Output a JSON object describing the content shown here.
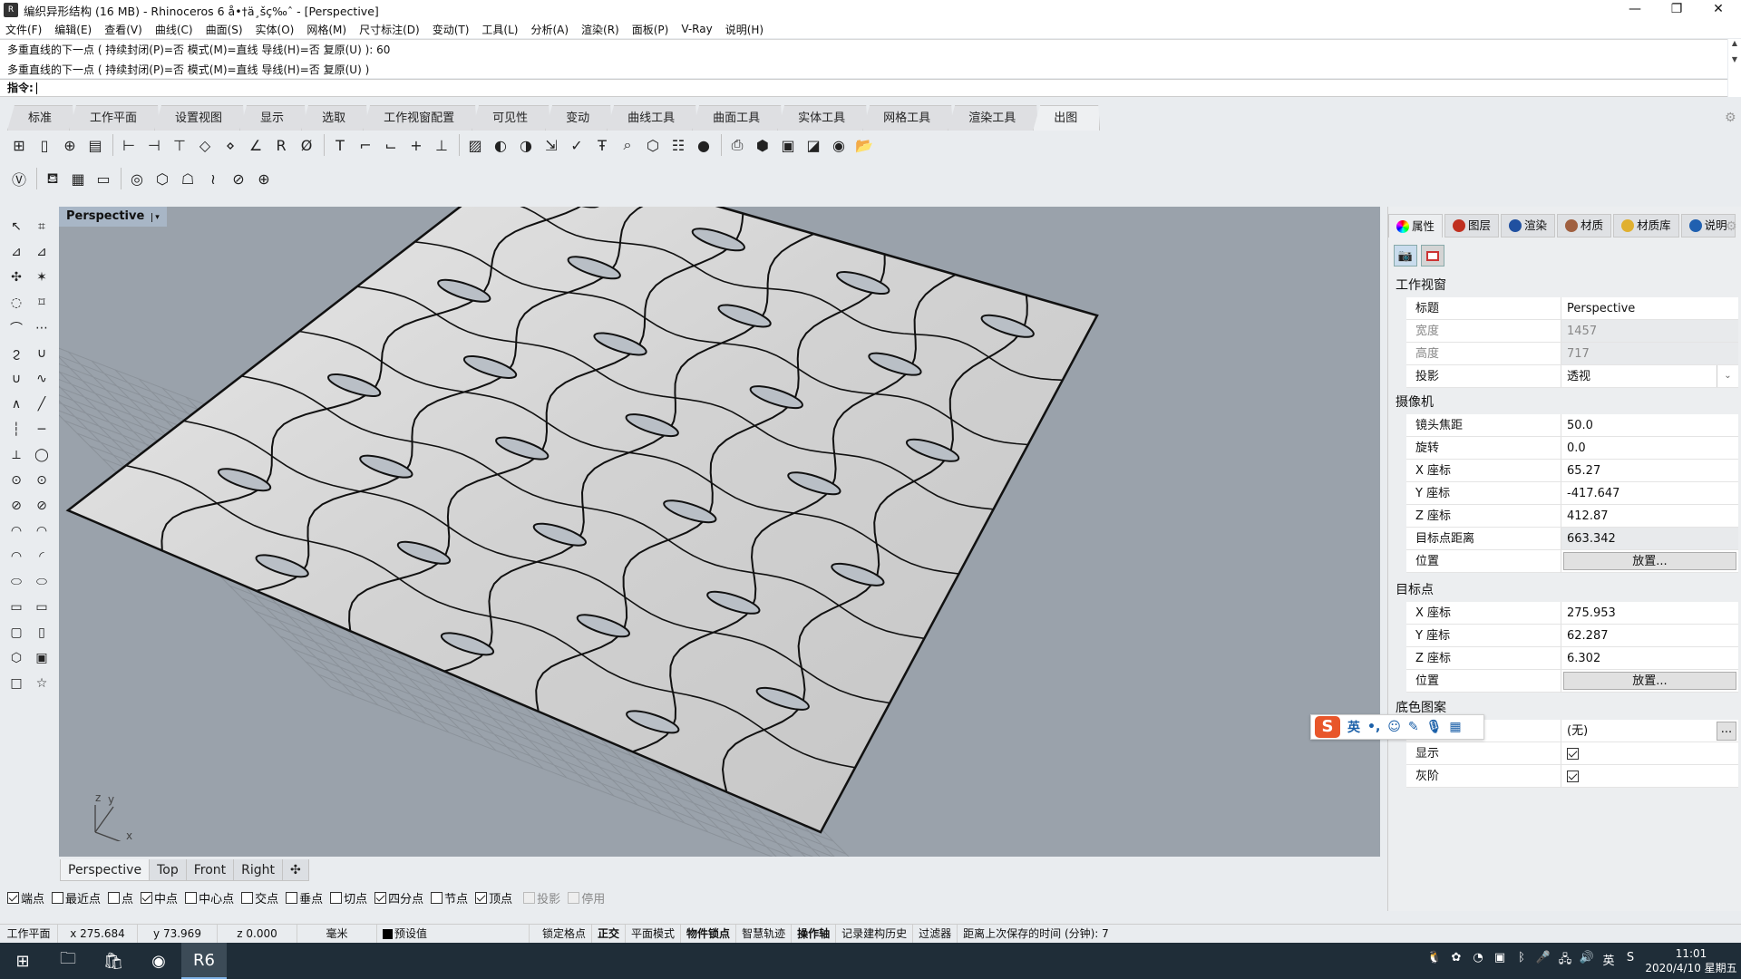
{
  "window": {
    "title": "编织异形结构 (16 MB) - Rhinoceros 6 å•†ä¸šç‰ˆ - [Perspective]",
    "app_icon": "rhino-app-icon",
    "controls": [
      "minimize-icon",
      "restore-icon",
      "close-icon"
    ],
    "minimize": "—",
    "restore": "❐",
    "close": "✕"
  },
  "menu": [
    "文件(F)",
    "编辑(E)",
    "查看(V)",
    "曲线(C)",
    "曲面(S)",
    "实体(O)",
    "网格(M)",
    "尺寸标注(D)",
    "变动(T)",
    "工具(L)",
    "分析(A)",
    "渲染(R)",
    "面板(P)",
    "V-Ray",
    "说明(H)"
  ],
  "command": {
    "history": [
      "多重直线的下一点 ( 持续封闭(P)=否  模式(M)=直线  导线(H)=否  复原(U) ): 60",
      "多重直线的下一点 ( 持续封闭(P)=否  模式(M)=直线  导线(H)=否  复原(U) )"
    ],
    "prompt_label": "指令:",
    "input_value": ""
  },
  "ribbon_tabs": [
    {
      "label": "标准",
      "active": false
    },
    {
      "label": "工作平面",
      "active": false
    },
    {
      "label": "设置视图",
      "active": false
    },
    {
      "label": "显示",
      "active": false
    },
    {
      "label": "选取",
      "active": false
    },
    {
      "label": "工作视窗配置",
      "active": false
    },
    {
      "label": "可见性",
      "active": false
    },
    {
      "label": "变动",
      "active": false
    },
    {
      "label": "曲线工具",
      "active": false
    },
    {
      "label": "曲面工具",
      "active": false
    },
    {
      "label": "实体工具",
      "active": false
    },
    {
      "label": "网格工具",
      "active": false
    },
    {
      "label": "渲染工具",
      "active": false
    },
    {
      "label": "出图",
      "active": true
    }
  ],
  "toolbar_row1": [
    {
      "icon": "layout-4view-icon",
      "glyph": "⊞"
    },
    {
      "icon": "new-page-icon",
      "glyph": "▯"
    },
    {
      "icon": "add-page-icon",
      "glyph": "⊕"
    },
    {
      "icon": "page-properties-icon",
      "glyph": "▤"
    },
    {
      "sep": true
    },
    {
      "icon": "dim-linear-icon",
      "glyph": "⊢"
    },
    {
      "icon": "dim-aligned-icon",
      "glyph": "⊣"
    },
    {
      "icon": "dim-rotated-icon",
      "glyph": "⊤"
    },
    {
      "icon": "dim-vertical-icon",
      "glyph": "◇"
    },
    {
      "icon": "dim-ordinate-icon",
      "glyph": "⋄"
    },
    {
      "icon": "dim-angle-icon",
      "glyph": "∠"
    },
    {
      "icon": "dim-radius-icon",
      "glyph": "R"
    },
    {
      "icon": "dim-diameter-icon",
      "glyph": "Ø"
    },
    {
      "sep": true
    },
    {
      "icon": "text-icon",
      "glyph": "T"
    },
    {
      "icon": "leader-icon",
      "glyph": "⌐"
    },
    {
      "icon": "dim-curve-icon",
      "glyph": "⌙"
    },
    {
      "icon": "point-icon",
      "glyph": "+"
    },
    {
      "icon": "dim-height-icon",
      "glyph": "⊥"
    },
    {
      "sep": true
    },
    {
      "icon": "hatch-icon",
      "glyph": "▨"
    },
    {
      "icon": "fill-icon",
      "glyph": "◐"
    },
    {
      "icon": "hatch-boundary-icon",
      "glyph": "◑"
    },
    {
      "icon": "dim-edit-icon",
      "glyph": "⇲"
    },
    {
      "icon": "dim-check-icon",
      "glyph": "✓"
    },
    {
      "icon": "text-edit-icon",
      "glyph": "Ŧ"
    },
    {
      "icon": "find-text-icon",
      "glyph": "⌕"
    },
    {
      "icon": "make-2d-icon",
      "glyph": "⬡"
    },
    {
      "icon": "annotation-styles-icon",
      "glyph": "☷"
    },
    {
      "icon": "dot-icon",
      "glyph": "●"
    },
    {
      "sep": true
    },
    {
      "icon": "print-icon",
      "glyph": "⎙"
    },
    {
      "icon": "clipping-plane-icon",
      "glyph": "⬢"
    },
    {
      "icon": "detail-icon",
      "glyph": "▣"
    },
    {
      "icon": "section-icon",
      "glyph": "◪"
    },
    {
      "icon": "text-dot-icon",
      "glyph": "◉"
    },
    {
      "icon": "open-folder-icon",
      "glyph": "📂"
    }
  ],
  "toolbar_row2": [
    {
      "icon": "vray-icon",
      "glyph": "Ⓥ"
    },
    {
      "sep": true
    },
    {
      "icon": "render-teapot-icon",
      "glyph": "⛾"
    },
    {
      "icon": "frame-buffer-icon",
      "glyph": "▦"
    },
    {
      "icon": "vray-window-icon",
      "glyph": "▭"
    },
    {
      "sep": true
    },
    {
      "icon": "asset-editor-icon",
      "glyph": "◎"
    },
    {
      "icon": "geometry-proxy-icon",
      "glyph": "⬡"
    },
    {
      "icon": "light-icon",
      "glyph": "☖"
    },
    {
      "icon": "fur-icon",
      "glyph": "≀"
    },
    {
      "icon": "clipper-icon",
      "glyph": "⊘"
    },
    {
      "icon": "vray-tools-icon",
      "glyph": "⊕"
    }
  ],
  "left_toolbar": [
    "select-icon",
    "points-on-icon",
    "gumball-icon",
    "planar-icon",
    "join-icon",
    "explode-icon",
    "control-points-icon",
    "edit-points-icon",
    "curve-interp-icon",
    "curve-cv-icon",
    "spiral-icon",
    "parabola-icon",
    "catenary-icon",
    "curve-blend-icon",
    "polyline-icon",
    "line-icon",
    "line-single-icon",
    "line-segment-icon",
    "line-normal-icon",
    "circle-tangent-icon",
    "circle-center-icon",
    "circle-3pt-icon",
    "circle-diameter-icon",
    "circle-tangent2-icon",
    "arc-center-icon",
    "arc-start-icon",
    "arc-3pt-icon",
    "arc-tangent-icon",
    "ellipse-center-icon",
    "ellipse-diameter-icon",
    "rectangle-icon",
    "rectangle-3pt-icon",
    "rounded-rect-icon",
    "rect-vertical-icon",
    "polygon-icon",
    "polygon-edge-icon",
    "square-icon",
    "star-icon"
  ],
  "viewport": {
    "title": "Perspective",
    "dropdown_glyph": "▾",
    "axes": {
      "x": "x",
      "y": "y",
      "z": "z"
    },
    "background": "#9aa2ab"
  },
  "viewport_tabs": [
    {
      "label": "Perspective",
      "active": true
    },
    {
      "label": "Top",
      "active": false
    },
    {
      "label": "Front",
      "active": false
    },
    {
      "label": "Right",
      "active": false
    },
    {
      "label": "✣",
      "active": false,
      "icon": "add-viewport-icon"
    }
  ],
  "osnaps": [
    {
      "label": "端点",
      "checked": true
    },
    {
      "label": "最近点",
      "checked": false
    },
    {
      "label": "点",
      "checked": false
    },
    {
      "label": "中点",
      "checked": true
    },
    {
      "label": "中心点",
      "checked": false
    },
    {
      "label": "交点",
      "checked": false
    },
    {
      "label": "垂点",
      "checked": false
    },
    {
      "label": "切点",
      "checked": false
    },
    {
      "label": "四分点",
      "checked": true
    },
    {
      "label": "节点",
      "checked": false
    },
    {
      "label": "顶点",
      "checked": true
    },
    {
      "label": "投影",
      "checked": false,
      "disabled": true
    },
    {
      "label": "停用",
      "checked": false,
      "disabled": true
    }
  ],
  "status_bar": {
    "cplane": "工作平面",
    "x": "x 275.684",
    "y": "y 73.969",
    "z": "z 0.000",
    "units": "毫米",
    "layer": "预设值",
    "layer_color": "#000000",
    "toggles": [
      {
        "label": "锁定格点",
        "bold": false
      },
      {
        "label": "正交",
        "bold": true
      },
      {
        "label": "平面模式",
        "bold": false
      },
      {
        "label": "物件锁点",
        "bold": true
      },
      {
        "label": "智慧轨迹",
        "bold": false
      },
      {
        "label": "操作轴",
        "bold": true
      },
      {
        "label": "记录建构历史",
        "bold": false
      },
      {
        "label": "过滤器",
        "bold": false
      }
    ],
    "save_time": "距离上次保存的时间 (分钟): 7"
  },
  "panel": {
    "tabs": [
      {
        "label": "属性",
        "icon": "color-wheel-icon",
        "color": "#e04040",
        "active": true
      },
      {
        "label": "图层",
        "icon": "layers-icon",
        "color": "#c03020",
        "active": false
      },
      {
        "label": "渲染",
        "icon": "render-sphere-icon",
        "color": "#2050a0",
        "active": false
      },
      {
        "label": "材质",
        "icon": "material-icon",
        "color": "#a06040",
        "active": false
      },
      {
        "label": "材质库",
        "icon": "library-folder-icon",
        "color": "#e0b030",
        "active": false
      },
      {
        "label": "说明",
        "icon": "help-icon",
        "color": "#2060b0",
        "active": false
      }
    ],
    "viewport_section": {
      "header": "工作视窗",
      "rows": [
        {
          "key": "标题",
          "value": "Perspective"
        },
        {
          "key": "宽度",
          "value": "1457",
          "disabled": true
        },
        {
          "key": "高度",
          "value": "717",
          "disabled": true
        },
        {
          "key": "投影",
          "value": "透视",
          "dropdown": true
        }
      ]
    },
    "camera_section": {
      "header": "摄像机",
      "rows": [
        {
          "key": "镜头焦距",
          "value": "50.0"
        },
        {
          "key": "旋转",
          "value": "0.0"
        },
        {
          "key": "X 座标",
          "value": "65.27"
        },
        {
          "key": "Y 座标",
          "value": "-417.647"
        },
        {
          "key": "Z 座标",
          "value": "412.87"
        },
        {
          "key": "目标点距离",
          "value": "663.342",
          "grey": true
        },
        {
          "key": "位置",
          "button": "放置..."
        }
      ]
    },
    "target_section": {
      "header": "目标点",
      "rows": [
        {
          "key": "X 座标",
          "value": "275.953"
        },
        {
          "key": "Y 座标",
          "value": "62.287"
        },
        {
          "key": "Z 座标",
          "value": "6.302"
        },
        {
          "key": "位置",
          "button": "放置..."
        }
      ]
    },
    "wallpaper_section": {
      "header": "底色图案",
      "rows": [
        {
          "key": "",
          "value": "(无)",
          "dots": "..."
        },
        {
          "key": "显示",
          "checkbox": true
        },
        {
          "key": "灰阶",
          "checkbox": true
        }
      ]
    }
  },
  "ime": {
    "logo": "S",
    "lang": "英",
    "punct": "•,",
    "icons": [
      "emoji-icon",
      "pen-icon",
      "mic-icon",
      "apps-grid-icon"
    ],
    "glyphs": [
      "☺",
      "✎",
      "🎙",
      "▦"
    ]
  },
  "taskbar": {
    "apps": [
      {
        "icon": "windows-start-icon",
        "glyph": "⊞"
      },
      {
        "icon": "file-explorer-icon",
        "glyph": "🗀"
      },
      {
        "icon": "ms-store-icon",
        "glyph": "🛍"
      },
      {
        "icon": "browser-icon",
        "glyph": "◉"
      },
      {
        "icon": "rhino-taskbar-icon",
        "glyph": "R6",
        "active": true
      }
    ],
    "tray": [
      {
        "icon": "qq-icon",
        "glyph": "🐧"
      },
      {
        "icon": "flower-app-icon",
        "glyph": "✿"
      },
      {
        "icon": "speaker-app-icon",
        "glyph": "◔"
      },
      {
        "icon": "nvidia-icon",
        "glyph": "▣"
      },
      {
        "icon": "bluetooth-icon",
        "glyph": "ᛒ"
      },
      {
        "icon": "microphone-icon",
        "glyph": "🎤"
      },
      {
        "icon": "network-icon",
        "glyph": "🖧"
      },
      {
        "icon": "volume-icon",
        "glyph": "🔊"
      },
      {
        "icon": "ime-lang-icon",
        "glyph": "英"
      },
      {
        "icon": "sogou-icon",
        "glyph": "S"
      }
    ],
    "time": "11:01",
    "date": "2020/4/10 星期五"
  }
}
